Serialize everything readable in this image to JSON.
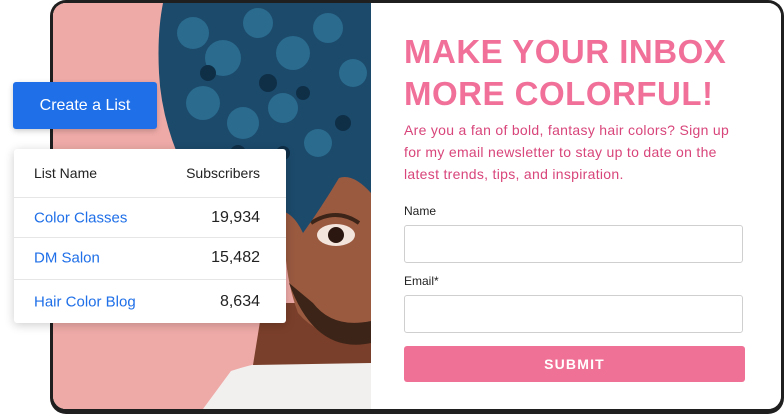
{
  "form": {
    "headline_line1": "MAKE YOUR INBOX",
    "headline_line2": "MORE COLORFUL!",
    "intro": "Are you a fan of bold, fantasy hair colors? Sign up for my email newsletter to stay up to date on the latest trends, tips, and inspiration.",
    "name_label": "Name",
    "name_value": "",
    "email_label": "Email*",
    "email_value": "",
    "submit_label": "SUBMIT"
  },
  "create_list": {
    "label": "Create a List"
  },
  "list_table": {
    "headers": [
      "List Name",
      "Subscribers"
    ],
    "rows": [
      {
        "name": "Color Classes",
        "subscribers": "19,934"
      },
      {
        "name": "DM Salon",
        "subscribers": "15,482"
      },
      {
        "name": "Hair Color Blog",
        "subscribers": "8,634"
      }
    ]
  },
  "colors": {
    "accent_pink": "#f0709a",
    "primary_blue": "#1f6fe8",
    "photo_background": "#eeaaa7",
    "hair_blue": "#1c4a6b"
  },
  "photo": {
    "subject": "person-with-blue-curly-hair"
  }
}
